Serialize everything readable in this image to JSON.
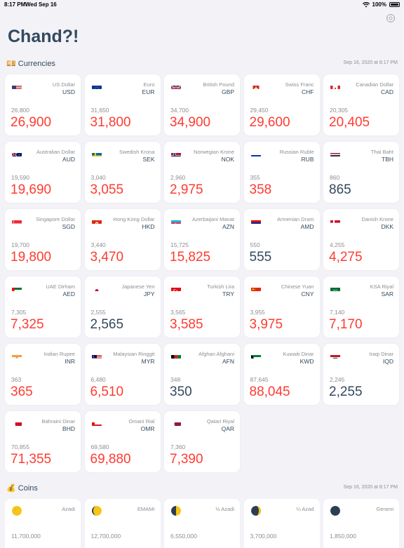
{
  "status_bar": {
    "time": "8:17 PM",
    "date": "Wed Sep 16",
    "battery": "100%"
  },
  "app": {
    "title": "Chand?!"
  },
  "currencies": {
    "label": "💴 Currencies",
    "timestamp": "Sep 16, 2020 at 8:17 PM",
    "items": [
      {
        "name": "US Dollar",
        "code": "USD",
        "prev": "26,800",
        "value": "26,900",
        "changed": true,
        "flag": "us"
      },
      {
        "name": "Euro",
        "code": "EUR",
        "prev": "31,650",
        "value": "31,800",
        "changed": true,
        "flag": "eu"
      },
      {
        "name": "British Pound",
        "code": "GBP",
        "prev": "34,700",
        "value": "34,900",
        "changed": true,
        "flag": "gb"
      },
      {
        "name": "Swiss Franc",
        "code": "CHF",
        "prev": "29,450",
        "value": "29,600",
        "changed": true,
        "flag": "ch"
      },
      {
        "name": "Canadian Dollar",
        "code": "CAD",
        "prev": "20,305",
        "value": "20,405",
        "changed": true,
        "flag": "ca"
      },
      {
        "name": "Australian Dollar",
        "code": "AUD",
        "prev": "19,590",
        "value": "19,690",
        "changed": true,
        "flag": "au"
      },
      {
        "name": "Swedish Krona",
        "code": "SEK",
        "prev": "3,040",
        "value": "3,055",
        "changed": true,
        "flag": "se"
      },
      {
        "name": "Norwegian Krone",
        "code": "NOK",
        "prev": "2,960",
        "value": "2,975",
        "changed": true,
        "flag": "no"
      },
      {
        "name": "Russian Ruble",
        "code": "RUB",
        "prev": "355",
        "value": "358",
        "changed": true,
        "flag": "ru"
      },
      {
        "name": "Thai Baht",
        "code": "TBH",
        "prev": "860",
        "value": "865",
        "changed": false,
        "flag": "th"
      },
      {
        "name": "Singapore Dollar",
        "code": "SGD",
        "prev": "19,700",
        "value": "19,800",
        "changed": true,
        "flag": "sg"
      },
      {
        "name": "Hong Kong Dollar",
        "code": "HKD",
        "prev": "3,440",
        "value": "3,470",
        "changed": true,
        "flag": "hk"
      },
      {
        "name": "Azerbaijani Manat",
        "code": "AZN",
        "prev": "15,725",
        "value": "15,825",
        "changed": true,
        "flag": "az"
      },
      {
        "name": "Armenian Dram",
        "code": "AMD",
        "prev": "550",
        "value": "555",
        "changed": false,
        "flag": "am"
      },
      {
        "name": "Danish Krone",
        "code": "DKK",
        "prev": "4,255",
        "value": "4,275",
        "changed": true,
        "flag": "dk"
      },
      {
        "name": "UAE Dirham",
        "code": "AED",
        "prev": "7,305",
        "value": "7,325",
        "changed": true,
        "flag": "ae"
      },
      {
        "name": "Japanese Yen",
        "code": "JPY",
        "prev": "2,555",
        "value": "2,565",
        "changed": false,
        "flag": "jp"
      },
      {
        "name": "Turkish Lira",
        "code": "TRY",
        "prev": "3,565",
        "value": "3,585",
        "changed": true,
        "flag": "tr"
      },
      {
        "name": "Chinese Yuan",
        "code": "CNY",
        "prev": "3,955",
        "value": "3,975",
        "changed": true,
        "flag": "cn"
      },
      {
        "name": "KSA Riyal",
        "code": "SAR",
        "prev": "7,140",
        "value": "7,170",
        "changed": true,
        "flag": "sa"
      },
      {
        "name": "Indian Rupee",
        "code": "INR",
        "prev": "363",
        "value": "365",
        "changed": true,
        "flag": "in"
      },
      {
        "name": "Malaysian Ringgit",
        "code": "MYR",
        "prev": "6,480",
        "value": "6,510",
        "changed": true,
        "flag": "my"
      },
      {
        "name": "Afghan Afghani",
        "code": "AFN",
        "prev": "348",
        "value": "350",
        "changed": false,
        "flag": "af"
      },
      {
        "name": "Kuwaiti Dinar",
        "code": "KWD",
        "prev": "87,645",
        "value": "88,045",
        "changed": true,
        "flag": "kw"
      },
      {
        "name": "Iraqi Dinar",
        "code": "IQD",
        "prev": "2,245",
        "value": "2,255",
        "changed": false,
        "flag": "iq"
      },
      {
        "name": "Bahraini Dinar",
        "code": "BHD",
        "prev": "70,855",
        "value": "71,355",
        "changed": true,
        "flag": "bh"
      },
      {
        "name": "Omani Rial",
        "code": "OMR",
        "prev": "69,580",
        "value": "69,880",
        "changed": true,
        "flag": "om"
      },
      {
        "name": "Qatari Riyal",
        "code": "QAR",
        "prev": "7,360",
        "value": "7,390",
        "changed": true,
        "flag": "qa"
      }
    ]
  },
  "coins": {
    "label": "💰 Coins",
    "timestamp": "Sep 16, 2020 at 8:17 PM",
    "items": [
      {
        "name": "Azadi",
        "prev": "11,700,000",
        "icon": "full-moon-icon"
      },
      {
        "name": "EMAMI",
        "prev": "12,700,000",
        "icon": "gibbous-moon-icon"
      },
      {
        "name": "½ Azadi",
        "prev": "6,550,000",
        "icon": "half-moon-icon"
      },
      {
        "name": "¼ Azad",
        "prev": "3,700,000",
        "icon": "crescent-moon-icon"
      },
      {
        "name": "Gerami",
        "prev": "1,850,000",
        "icon": "new-moon-icon"
      }
    ]
  },
  "colors": {
    "up": "#ff3b30",
    "neutral": "#34495e",
    "muted": "#8e8e93",
    "background": "#f2f2f7"
  }
}
